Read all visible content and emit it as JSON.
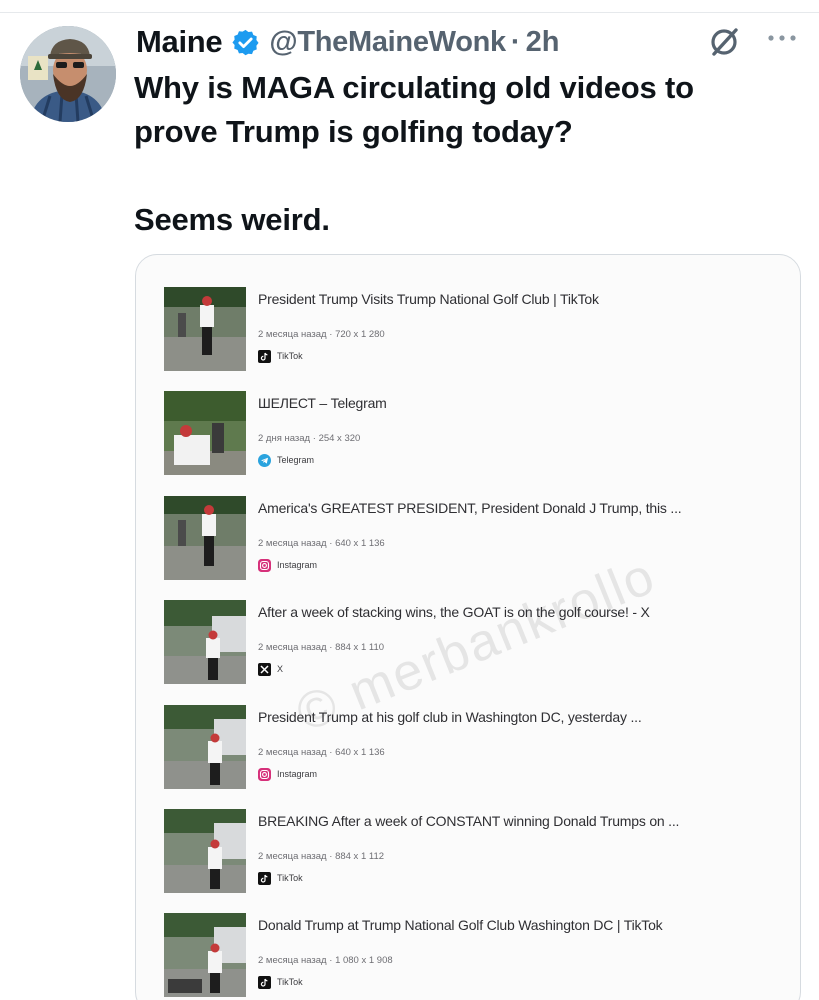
{
  "tweet": {
    "author_name": "Maine",
    "handle": "@TheMaineWonk",
    "separator": "·",
    "time": "2h",
    "text_lines": [
      "Why is MAGA circulating old videos to",
      "prove Trump is golfing today?"
    ],
    "text_line_2": "Seems weird.",
    "colors": {
      "verified": "#1d9bf0",
      "muted": "#566370"
    }
  },
  "card": {
    "watermark": "© merbankrollo",
    "results": [
      {
        "title": "President Trump Visits Trump National Golf Club | TikTok",
        "age": "2 месяца назад",
        "dims": "720 x 1 280",
        "source": "TikTok",
        "icon": "tiktok-icon"
      },
      {
        "title": "ШЕЛЕСТ – Telegram",
        "age": "2 дня назад",
        "dims": "254 x 320",
        "source": "Telegram",
        "icon": "telegram-icon"
      },
      {
        "title": "America's GREATEST PRESIDENT, President Donald J Trump, this ...",
        "age": "2 месяца назад",
        "dims": "640 x 1 136",
        "source": "Instagram",
        "icon": "instagram-icon"
      },
      {
        "title": "After a week of stacking wins, the GOAT is on the golf course! - X",
        "age": "2 месяца назад",
        "dims": "884 x 1 110",
        "source": "X",
        "icon": "x-icon"
      },
      {
        "title": "President Trump at his golf club in Washington DC, yesterday ...",
        "age": "2 месяца назад",
        "dims": "640 x 1 136",
        "source": "Instagram",
        "icon": "instagram-icon"
      },
      {
        "title": "BREAKING After a week of CONSTANT winning Donald Trumps on ...",
        "age": "2 месяца назад",
        "dims": "884 x 1 112",
        "source": "TikTok",
        "icon": "tiktok-icon"
      },
      {
        "title": "Donald Trump at Trump National Golf Club Washington DC | TikTok",
        "age": "2 месяца назад",
        "dims": "1 080 x 1 908",
        "source": "TikTok",
        "icon": "tiktok-icon"
      }
    ]
  }
}
